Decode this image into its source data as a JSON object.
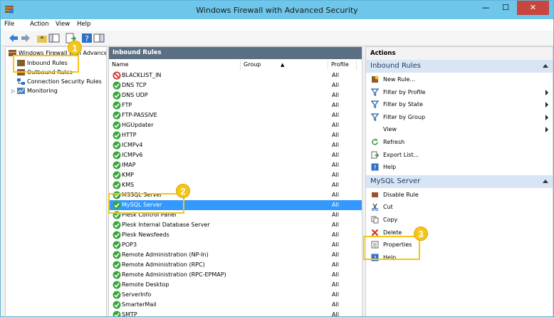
{
  "window": {
    "title": "Windows Firewall with Advanced Security"
  },
  "menu": [
    "File",
    "Action",
    "View",
    "Help"
  ],
  "tree": {
    "root": "Windows Firewall with Advance",
    "items": [
      "Inbound Rules",
      "Outbound Rules",
      "Connection Security Rules",
      "Monitoring"
    ]
  },
  "center": {
    "header": "Inbound Rules",
    "columns": {
      "name": "Name",
      "group": "Group",
      "profile": "Profile"
    },
    "rules": [
      {
        "name": "BLACKLIST_IN",
        "profile": "All",
        "status": "block"
      },
      {
        "name": "DNS TCP",
        "profile": "All",
        "status": "allow"
      },
      {
        "name": "DNS UDP",
        "profile": "All",
        "status": "allow"
      },
      {
        "name": "FTP",
        "profile": "All",
        "status": "allow"
      },
      {
        "name": "FTP-PASSIVE",
        "profile": "All",
        "status": "allow"
      },
      {
        "name": "HGUpdater",
        "profile": "All",
        "status": "allow"
      },
      {
        "name": "HTTP",
        "profile": "All",
        "status": "allow"
      },
      {
        "name": "ICMPv4",
        "profile": "All",
        "status": "allow"
      },
      {
        "name": "ICMPv6",
        "profile": "All",
        "status": "allow"
      },
      {
        "name": "IMAP",
        "profile": "All",
        "status": "allow"
      },
      {
        "name": "KMP",
        "profile": "All",
        "status": "allow"
      },
      {
        "name": "KMS",
        "profile": "All",
        "status": "allow"
      },
      {
        "name": "MSSQL Server",
        "profile": "All",
        "status": "allow"
      },
      {
        "name": "MySQL Server",
        "profile": "All",
        "status": "allow",
        "selected": true
      },
      {
        "name": "Plesk Control Panel",
        "profile": "All",
        "status": "allow"
      },
      {
        "name": "Plesk Internal Database Server",
        "profile": "All",
        "status": "allow"
      },
      {
        "name": "Plesk Newsfeeds",
        "profile": "All",
        "status": "allow"
      },
      {
        "name": "POP3",
        "profile": "All",
        "status": "allow"
      },
      {
        "name": "Remote Administration (NP-In)",
        "profile": "All",
        "status": "allow"
      },
      {
        "name": "Remote Administration (RPC)",
        "profile": "All",
        "status": "allow"
      },
      {
        "name": "Remote Administration (RPC-EPMAP)",
        "profile": "All",
        "status": "allow"
      },
      {
        "name": "Remote Desktop",
        "profile": "All",
        "status": "allow"
      },
      {
        "name": "ServerInfo",
        "profile": "All",
        "status": "allow"
      },
      {
        "name": "SmarterMail",
        "profile": "All",
        "status": "allow"
      },
      {
        "name": "SMTP",
        "profile": "All",
        "status": "allow"
      }
    ]
  },
  "actions": {
    "title": "Actions",
    "sections": [
      {
        "header": "Inbound Rules",
        "items": [
          {
            "label": "New Rule...",
            "icon": "new-rule-icon"
          },
          {
            "label": "Filter by Profile",
            "icon": "filter-icon",
            "submenu": true
          },
          {
            "label": "Filter by State",
            "icon": "filter-icon",
            "submenu": true
          },
          {
            "label": "Filter by Group",
            "icon": "filter-icon",
            "submenu": true
          },
          {
            "label": "View",
            "icon": "",
            "submenu": true
          },
          {
            "label": "Refresh",
            "icon": "refresh-icon"
          },
          {
            "label": "Export List...",
            "icon": "export-icon"
          },
          {
            "label": "Help",
            "icon": "help-icon"
          }
        ]
      },
      {
        "header": "MySQL Server",
        "items": [
          {
            "label": "Disable Rule",
            "icon": "disable-icon"
          },
          {
            "label": "Cut",
            "icon": "cut-icon"
          },
          {
            "label": "Copy",
            "icon": "copy-icon"
          },
          {
            "label": "Delete",
            "icon": "delete-icon"
          },
          {
            "label": "Properties",
            "icon": "properties-icon"
          },
          {
            "label": "Help",
            "icon": "help-icon"
          }
        ]
      }
    ]
  },
  "callouts": [
    "1",
    "2",
    "3"
  ],
  "colors": {
    "titlebar": "#6ec6ea",
    "selection": "#3399ff",
    "callout": "#f5c518",
    "header": "#5b6f82",
    "allow": "#3aa53a",
    "block": "#d0302a"
  }
}
